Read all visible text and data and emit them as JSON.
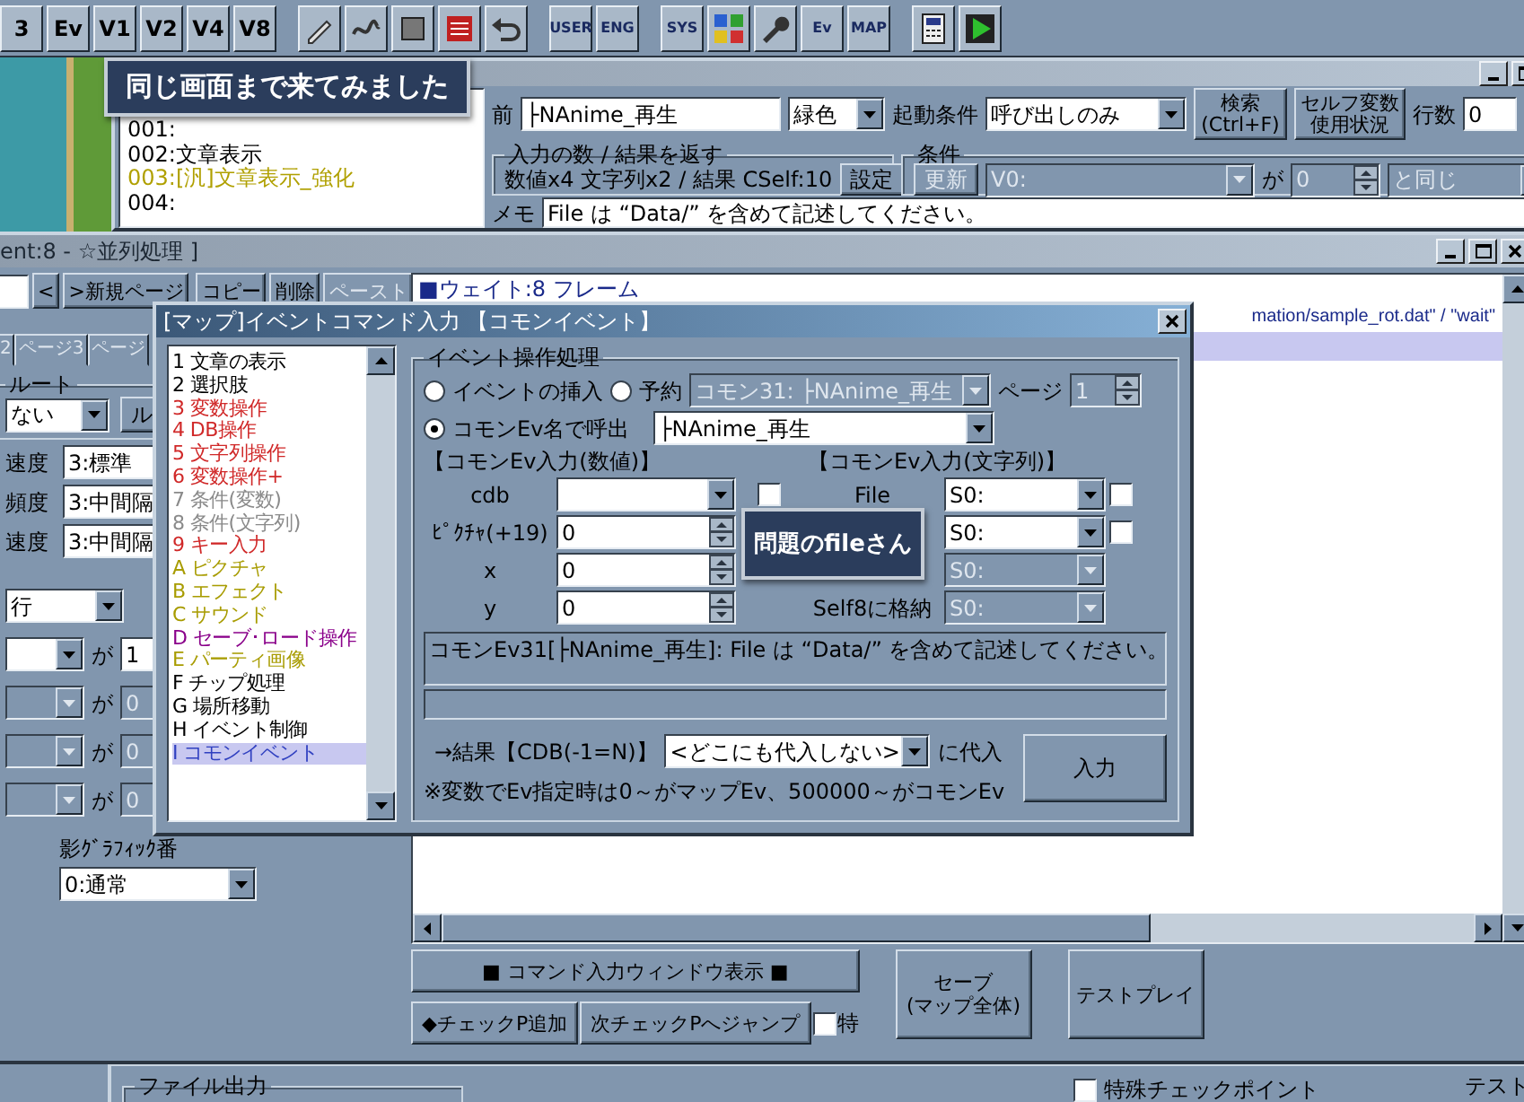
{
  "toolbar": {
    "groups": [
      [
        {
          "kind": "text",
          "label": "3"
        },
        {
          "kind": "text",
          "label": "Ev"
        },
        {
          "kind": "text",
          "label": "V1"
        },
        {
          "kind": "text",
          "label": "V2"
        },
        {
          "kind": "text",
          "label": "V4"
        },
        {
          "kind": "text",
          "label": "V8"
        }
      ],
      [
        {
          "kind": "pencil"
        },
        {
          "kind": "squiggle"
        },
        {
          "kind": "square"
        },
        {
          "kind": "sheet"
        },
        {
          "kind": "undo"
        }
      ],
      [
        {
          "kind": "labeled",
          "label": "USER"
        },
        {
          "kind": "labeled",
          "label": "ENG"
        }
      ],
      [
        {
          "kind": "labeled",
          "label": "SYS"
        },
        {
          "kind": "grid"
        },
        {
          "kind": "wrench"
        },
        {
          "kind": "labeled",
          "label": "Ev"
        },
        {
          "kind": "labeled",
          "label": "MAP"
        }
      ],
      [
        {
          "kind": "calculator"
        },
        {
          "kind": "play"
        }
      ]
    ]
  },
  "common_event_editor": {
    "list": [
      {
        "text": "001:",
        "color": "#000000"
      },
      {
        "text": "002:文章表示",
        "color": "#000000"
      },
      {
        "text": "003:[汎]文章表示_強化",
        "color": "#b0a000"
      },
      {
        "text": "004:",
        "color": "#000000"
      }
    ],
    "name_label": "前",
    "name": "├NAnime_再生",
    "color_choice": "緑色",
    "trigger_label": "起動条件",
    "trigger": "呼び出しのみ",
    "search_button": "検索\n(Ctrl+F)",
    "self_var_button": "セルフ変数使用状況",
    "rows_label": "行数",
    "rows": "0",
    "io_group": {
      "title": "入力の数 / 結果を返す",
      "summary": "数値x4 文字列x2 / 結果 CSelf:10",
      "button": "設定"
    },
    "condition_group": {
      "title": "条件",
      "update_button": "更新",
      "variable": "V0:",
      "ga": "が",
      "value": "0",
      "comparison": "と同じ"
    },
    "memo_label": "メモ",
    "memo": "File は “Data/” を含めて記述してください。"
  },
  "event_window": {
    "title": "ent:8 - ☆並列処理 ]",
    "nav_buttons": [
      {
        "label": "<",
        "disabled": false
      },
      {
        "label": ">新規ページ",
        "disabled": false
      }
    ],
    "edit_buttons": [
      {
        "label": "コピー",
        "disabled": false
      },
      {
        "label": "削除",
        "disabled": false
      },
      {
        "label": "ペースト",
        "disabled": true
      }
    ],
    "tabs": [
      {
        "label": "2",
        "selected": false
      },
      {
        "label": "ページ3",
        "selected": false
      },
      {
        "label": "ページ",
        "selected": false
      }
    ],
    "route_group": "ルート",
    "route_choice": "ない",
    "route_button": "ル",
    "speeds": [
      {
        "label": "速度",
        "value": "3:標準"
      },
      {
        "label": "頻度",
        "value": "3:中間隔"
      },
      {
        "label": "速度",
        "value": "3:中間隔"
      }
    ],
    "condition_mode": "行",
    "conditions": [
      {
        "ga": "が",
        "value": "1",
        "disabled": false
      },
      {
        "ga": "が",
        "value": "0",
        "disabled": true
      },
      {
        "ga": "が",
        "value": "0",
        "disabled": true
      },
      {
        "ga": "が",
        "value": "0",
        "disabled": true
      }
    ],
    "shadow_label": "影ｸﾞﾗﾌｨｯｸ番",
    "shadow_value": "0:通常",
    "commands": [
      {
        "kind": "full",
        "text": "■ウェイト:8 フレーム",
        "selected": false
      },
      {
        "kind": "partial",
        "text": "mation/sample_rot.dat\" / \"wait\"",
        "selected": false
      },
      {
        "kind": "full",
        "selected": true
      }
    ],
    "show_command_window": "■ コマンド入力ウィンドウ表示 ■",
    "add_checkpoint": "◆チェックP追加",
    "next_checkpoint": "次チェックPへジャンプ",
    "special_check": {
      "label": "特",
      "checked": false
    },
    "save_button": "セーブ\n(マップ全体)",
    "testplay_button": "テストプレイ"
  },
  "bottom_window": {
    "file_output": "ファイル出力",
    "special_checkpoint": {
      "label": "特殊チェックポイント",
      "checked": false
    },
    "test_play": "テスト"
  },
  "command_dialog": {
    "title": "[マップ]イベントコマンド入力 【コモンイベント】",
    "commands": [
      {
        "label": "1 文章の表示",
        "color": "#000000",
        "selected": false
      },
      {
        "label": "2 選択肢",
        "color": "#000000",
        "selected": false
      },
      {
        "label": "3 変数操作",
        "color": "#d02828",
        "selected": false
      },
      {
        "label": "4 DB操作",
        "color": "#d02828",
        "selected": false
      },
      {
        "label": "5 文字列操作",
        "color": "#d02828",
        "selected": false
      },
      {
        "label": "6 変数操作+",
        "color": "#d02828",
        "selected": false
      },
      {
        "label": "7 条件(変数)",
        "color": "#8a8a8a",
        "selected": false
      },
      {
        "label": "8 条件(文字列)",
        "color": "#8a8a8a",
        "selected": false
      },
      {
        "label": "9 キー入力",
        "color": "#d02828",
        "selected": false
      },
      {
        "label": "A ピクチャ",
        "color": "#a89c00",
        "selected": false
      },
      {
        "label": "B エフェクト",
        "color": "#a89c00",
        "selected": false
      },
      {
        "label": "C サウンド",
        "color": "#a89c00",
        "selected": false
      },
      {
        "label": "D セーブ･ロード操作",
        "color": "#8a008a",
        "selected": false
      },
      {
        "label": "E パーティ画像",
        "color": "#a89c00",
        "selected": false
      },
      {
        "label": "F チップ処理",
        "color": "#000000",
        "selected": false
      },
      {
        "label": "G 場所移動",
        "color": "#000000",
        "selected": false
      },
      {
        "label": "H イベント制御",
        "color": "#000000",
        "selected": false
      },
      {
        "label": "I コモンイベント",
        "color": "#3040c0",
        "selected": true
      }
    ],
    "group_title": "イベント操作処理",
    "insert_radio": {
      "label": "イベントの挿入",
      "selected": false
    },
    "reserve_radio": {
      "label": "予約",
      "selected": false
    },
    "reserve_target": "コモン31: ├NAnime_再生",
    "page_label": "ページ",
    "page": "1",
    "call_by_name_radio": {
      "label": "コモンEv名で呼出",
      "selected": true
    },
    "event_name": "├NAnime_再生",
    "numeric_heading": "【コモンEv入力(数値)】",
    "string_heading": "【コモンEv入力(文字列)】",
    "numeric_inputs": [
      {
        "kind": "combo",
        "label": "cdb",
        "checked": false
      },
      {
        "kind": "spin",
        "label": "ﾋﾟｸﾁｬ(+19)",
        "value": "0"
      },
      {
        "kind": "spin",
        "label": "x",
        "value": "0"
      },
      {
        "kind": "spin",
        "label": "y",
        "value": "0"
      }
    ],
    "string_inputs": [
      {
        "label": "File",
        "value": "S0:",
        "disabled": false,
        "checked": false
      },
      {
        "value": "S0:",
        "disabled": false,
        "checked": false
      },
      {
        "value": "S0:",
        "disabled": true
      },
      {
        "label": "Self8に格納",
        "value": "S0:",
        "disabled": true
      }
    ],
    "message": "コモンEv31[├NAnime_再生]: File は “Data/” を含めて記述してください。",
    "result_label": "→結果【CDB(-1=N)】",
    "result_target": "<どこにも代入しない>",
    "assign_label": "に代入",
    "enter_button": "入力",
    "note": "※変数でEv指定時は0～がマップEv、500000～がコモンEv"
  },
  "notes": [
    {
      "text": "同じ画面まで来てみました"
    },
    {
      "text": "問題のfileさん"
    }
  ]
}
